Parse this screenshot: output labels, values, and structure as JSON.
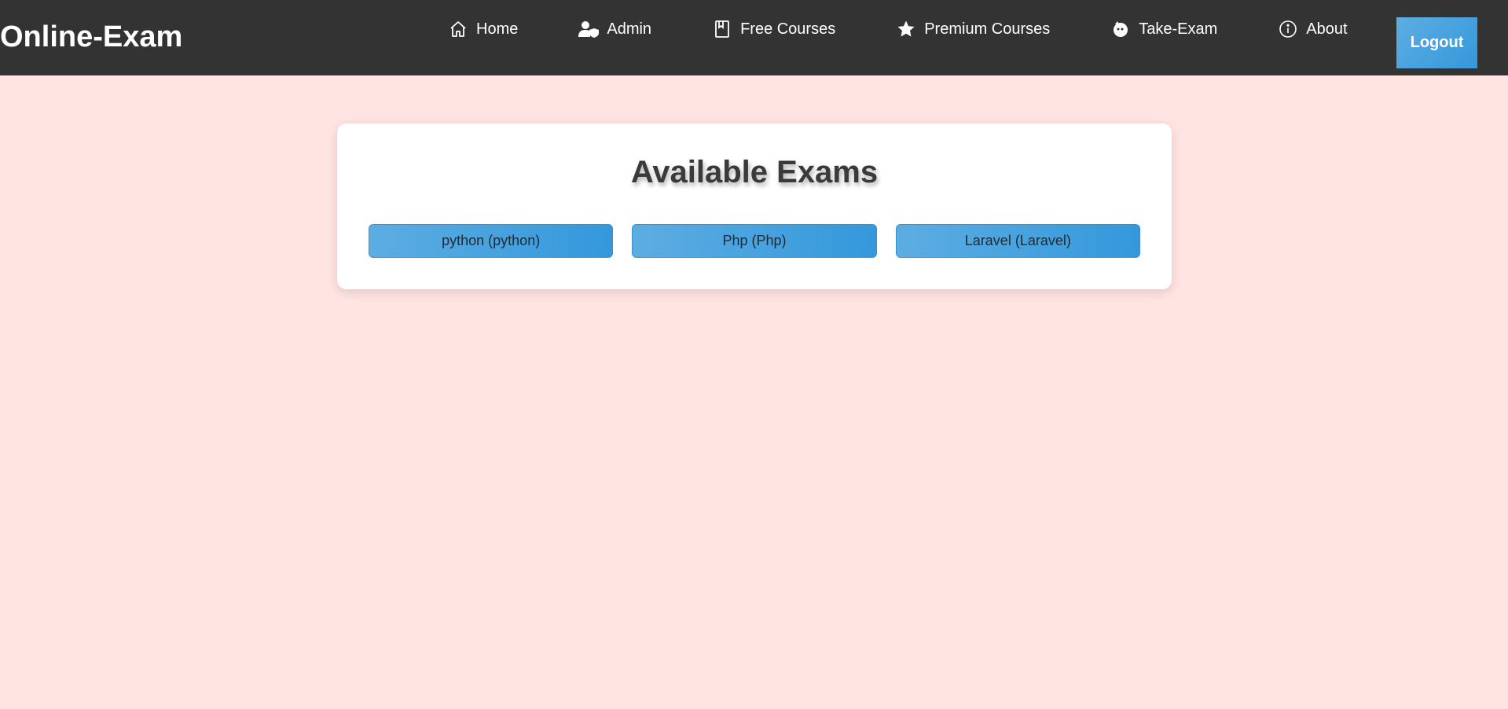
{
  "brand": {
    "title": "Online-Exam"
  },
  "nav": {
    "items": [
      {
        "label": "Home",
        "icon": "home-icon"
      },
      {
        "label": "Admin",
        "icon": "admin-user-shield-icon"
      },
      {
        "label": "Free Courses",
        "icon": "book-icon"
      },
      {
        "label": "Premium Courses",
        "icon": "star-icon"
      },
      {
        "label": "Take-Exam",
        "icon": "face-icon"
      },
      {
        "label": "About",
        "icon": "info-circle-icon"
      }
    ],
    "logout_label": "Logout"
  },
  "main": {
    "title": "Available Exams",
    "exams": [
      {
        "label": "python (python)"
      },
      {
        "label": "Php (Php)"
      },
      {
        "label": "Laravel (Laravel)"
      }
    ]
  },
  "colors": {
    "navbar_bg": "#333333",
    "page_bg": "#ffe4e1",
    "accent": "#3498db",
    "accent_light": "#5dade2"
  }
}
